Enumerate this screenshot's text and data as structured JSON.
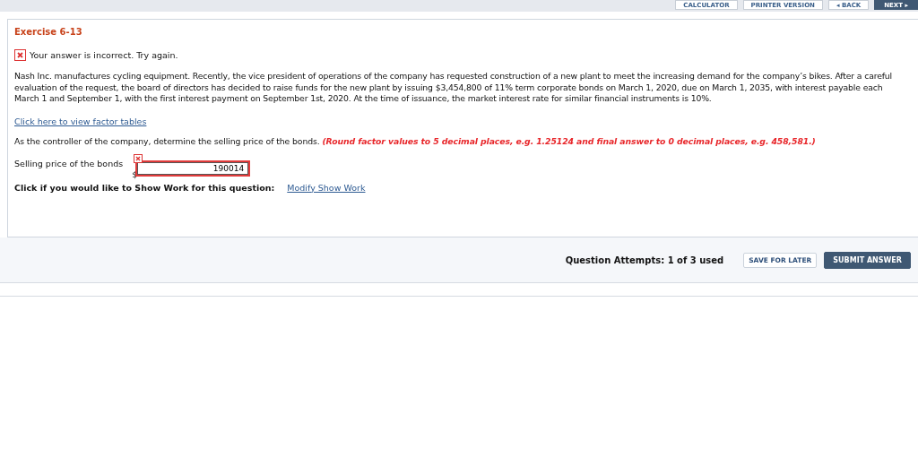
{
  "toolbar": {
    "buttons": [
      {
        "label": "CALCULATOR",
        "kind": "plain"
      },
      {
        "label": "PRINTER VERSION",
        "kind": "plain"
      },
      {
        "label": "◂ BACK",
        "kind": "plain"
      },
      {
        "label": "NEXT ▸",
        "kind": "primary"
      }
    ]
  },
  "exercise": {
    "title": "Exercise 6-13",
    "feedback": "Your answer is incorrect.  Try again.",
    "problem": "Nash Inc. manufactures cycling equipment. Recently, the vice president of operations of the company has requested construction of a new plant to meet the increasing demand for the company’s bikes. After a careful evaluation of the request, the board of directors has decided to raise funds for the new plant by issuing $3,454,800 of 11% term corporate bonds on March 1, 2020, due on March 1, 2035, with interest payable each March 1 and September 1, with the first interest payment on September 1st, 2020. At the time of issuance, the market interest rate for similar financial instruments is 10%.",
    "link": "Click here to view factor tables",
    "question": "As the controller of the company, determine the selling price of the bonds.",
    "instruction": "(Round factor values to 5 decimal places, e.g. 1.25124 and final answer to 0 decimal places, e.g. 458,581.)",
    "answer": {
      "label": "Selling price of the bonds",
      "currency": "$",
      "value": "190014",
      "correct": false
    },
    "show_work": {
      "label": "Click if you would like to Show Work for this question:",
      "link": "Modify Show Work"
    }
  },
  "footer": {
    "attempts": "Question Attempts: 1 of 3 used",
    "buttons": [
      {
        "label": "SAVE FOR LATER",
        "kind": "plain"
      },
      {
        "label": "SUBMIT ANSWER",
        "kind": "primary"
      }
    ]
  }
}
